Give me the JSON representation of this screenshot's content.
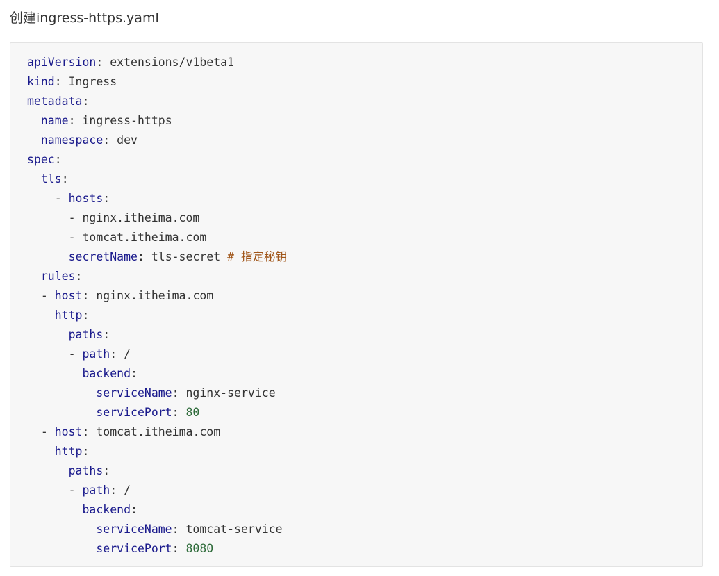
{
  "heading": "创建ingress-https.yaml",
  "colors": {
    "key": "#1a1a8c",
    "string": "#333333",
    "number": "#2e6b3a",
    "comment": "#a0561a",
    "block_bg": "#f7f7f7",
    "block_border": "#e3e3e3"
  },
  "code_lines": [
    [
      {
        "t": "key",
        "v": "apiVersion"
      },
      {
        "t": "str",
        "v": ": extensions/v1beta1"
      }
    ],
    [
      {
        "t": "key",
        "v": "kind"
      },
      {
        "t": "str",
        "v": ": Ingress"
      }
    ],
    [
      {
        "t": "key",
        "v": "metadata"
      },
      {
        "t": "str",
        "v": ":"
      }
    ],
    [
      {
        "t": "str",
        "v": "  "
      },
      {
        "t": "key",
        "v": "name"
      },
      {
        "t": "str",
        "v": ": ingress-https"
      }
    ],
    [
      {
        "t": "str",
        "v": "  "
      },
      {
        "t": "key",
        "v": "namespace"
      },
      {
        "t": "str",
        "v": ": dev"
      }
    ],
    [
      {
        "t": "key",
        "v": "spec"
      },
      {
        "t": "str",
        "v": ":"
      }
    ],
    [
      {
        "t": "str",
        "v": "  "
      },
      {
        "t": "key",
        "v": "tls"
      },
      {
        "t": "str",
        "v": ":"
      }
    ],
    [
      {
        "t": "str",
        "v": "    - "
      },
      {
        "t": "key",
        "v": "hosts"
      },
      {
        "t": "str",
        "v": ":"
      }
    ],
    [
      {
        "t": "str",
        "v": "      - nginx.itheima.com"
      }
    ],
    [
      {
        "t": "str",
        "v": "      - tomcat.itheima.com"
      }
    ],
    [
      {
        "t": "str",
        "v": "      "
      },
      {
        "t": "key",
        "v": "secretName"
      },
      {
        "t": "str",
        "v": ": tls-secret "
      },
      {
        "t": "cmt",
        "v": "# 指定秘钥"
      }
    ],
    [
      {
        "t": "str",
        "v": "  "
      },
      {
        "t": "key",
        "v": "rules"
      },
      {
        "t": "str",
        "v": ":"
      }
    ],
    [
      {
        "t": "str",
        "v": "  - "
      },
      {
        "t": "key",
        "v": "host"
      },
      {
        "t": "str",
        "v": ": nginx.itheima.com"
      }
    ],
    [
      {
        "t": "str",
        "v": "    "
      },
      {
        "t": "key",
        "v": "http"
      },
      {
        "t": "str",
        "v": ":"
      }
    ],
    [
      {
        "t": "str",
        "v": "      "
      },
      {
        "t": "key",
        "v": "paths"
      },
      {
        "t": "str",
        "v": ":"
      }
    ],
    [
      {
        "t": "str",
        "v": "      - "
      },
      {
        "t": "key",
        "v": "path"
      },
      {
        "t": "str",
        "v": ": /"
      }
    ],
    [
      {
        "t": "str",
        "v": "        "
      },
      {
        "t": "key",
        "v": "backend"
      },
      {
        "t": "str",
        "v": ":"
      }
    ],
    [
      {
        "t": "str",
        "v": "          "
      },
      {
        "t": "key",
        "v": "serviceName"
      },
      {
        "t": "str",
        "v": ": nginx-service"
      }
    ],
    [
      {
        "t": "str",
        "v": "          "
      },
      {
        "t": "key",
        "v": "servicePort"
      },
      {
        "t": "str",
        "v": ": "
      },
      {
        "t": "num",
        "v": "80"
      }
    ],
    [
      {
        "t": "str",
        "v": "  - "
      },
      {
        "t": "key",
        "v": "host"
      },
      {
        "t": "str",
        "v": ": tomcat.itheima.com"
      }
    ],
    [
      {
        "t": "str",
        "v": "    "
      },
      {
        "t": "key",
        "v": "http"
      },
      {
        "t": "str",
        "v": ":"
      }
    ],
    [
      {
        "t": "str",
        "v": "      "
      },
      {
        "t": "key",
        "v": "paths"
      },
      {
        "t": "str",
        "v": ":"
      }
    ],
    [
      {
        "t": "str",
        "v": "      - "
      },
      {
        "t": "key",
        "v": "path"
      },
      {
        "t": "str",
        "v": ": /"
      }
    ],
    [
      {
        "t": "str",
        "v": "        "
      },
      {
        "t": "key",
        "v": "backend"
      },
      {
        "t": "str",
        "v": ":"
      }
    ],
    [
      {
        "t": "str",
        "v": "          "
      },
      {
        "t": "key",
        "v": "serviceName"
      },
      {
        "t": "str",
        "v": ": tomcat-service"
      }
    ],
    [
      {
        "t": "str",
        "v": "          "
      },
      {
        "t": "key",
        "v": "servicePort"
      },
      {
        "t": "str",
        "v": ": "
      },
      {
        "t": "num",
        "v": "8080"
      }
    ]
  ]
}
